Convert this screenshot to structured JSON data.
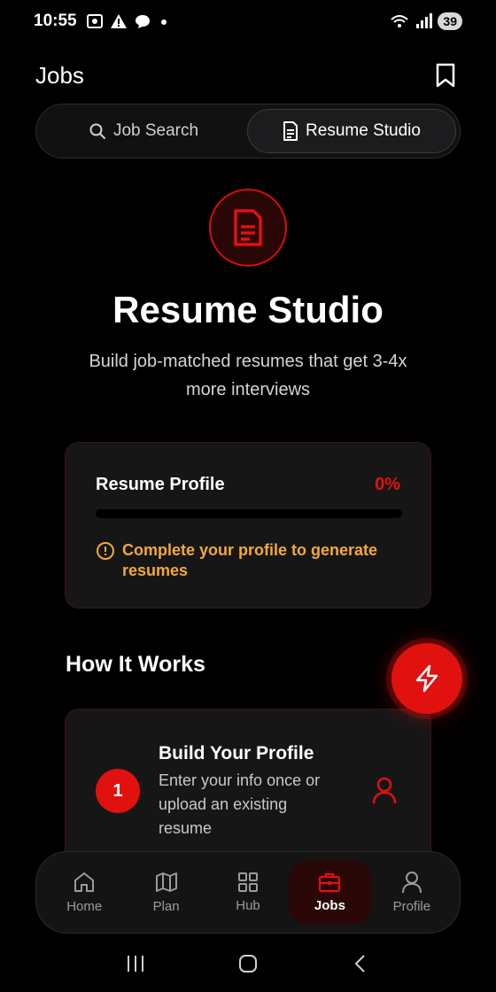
{
  "status_bar": {
    "time": "10:55",
    "battery": "39",
    "icons": [
      "screenshot-icon",
      "alert-icon",
      "chat-bubble-icon",
      "dot-icon",
      "wifi-icon",
      "signal-icon"
    ]
  },
  "header": {
    "title": "Jobs",
    "bookmark_icon": "bookmark-icon"
  },
  "tabs": [
    {
      "label": "Job Search",
      "icon": "search-icon",
      "active": false
    },
    {
      "label": "Resume Studio",
      "icon": "document-icon",
      "active": true
    }
  ],
  "hero": {
    "icon": "document-icon",
    "title": "Resume Studio",
    "subtitle": "Build job-matched resumes that get 3-4x more interviews"
  },
  "profile_card": {
    "label": "Resume Profile",
    "percent": "0%",
    "progress": 0,
    "warning": "Complete your profile to generate resumes"
  },
  "how_it_works": {
    "title": "How It Works",
    "steps": [
      {
        "number": "1",
        "title": "Build Your Profile",
        "description": "Enter your info once or upload an existing resume",
        "icon": "user-icon"
      }
    ]
  },
  "fab": {
    "icon": "lightning-icon"
  },
  "bottom_nav": [
    {
      "label": "Home",
      "icon": "home-icon",
      "active": false
    },
    {
      "label": "Plan",
      "icon": "map-icon",
      "active": false
    },
    {
      "label": "Hub",
      "icon": "grid-icon",
      "active": false
    },
    {
      "label": "Jobs",
      "icon": "briefcase-icon",
      "active": true
    },
    {
      "label": "Profile",
      "icon": "user-icon",
      "active": false
    }
  ],
  "colors": {
    "accent": "#e0110f",
    "warning": "#f2a93b",
    "background": "#000000",
    "card": "#161617"
  }
}
